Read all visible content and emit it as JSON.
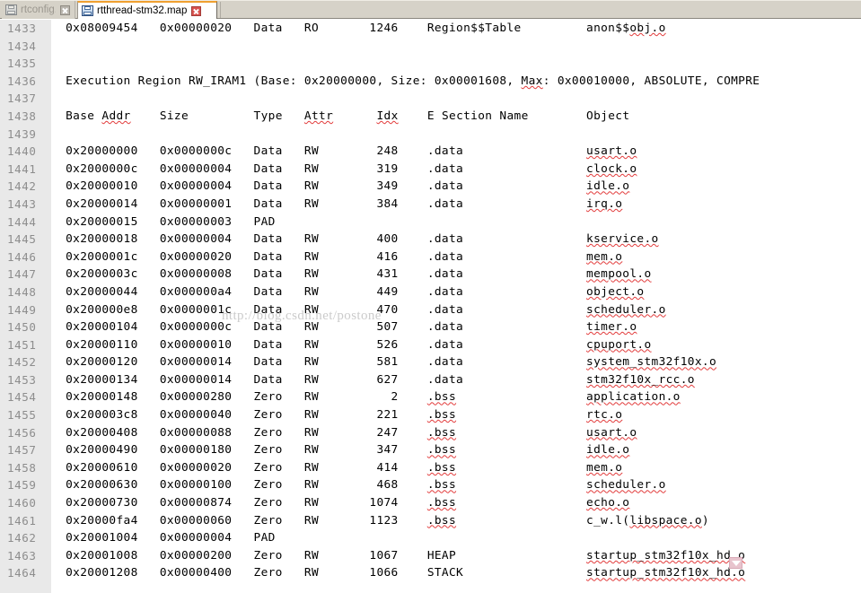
{
  "window": {
    "title": "rtthread-stm32.map"
  },
  "tabs": [
    {
      "label": "rtconfig.h",
      "icon": "save-file-icon",
      "close_icon": "close-icon",
      "active": false
    },
    {
      "label": "rtthread-stm32.map",
      "icon": "save-file-icon",
      "close_icon": "close-icon",
      "active": true
    }
  ],
  "watermark": "http://blog.csdn.net/postone",
  "editor": {
    "first_line_number": 1433,
    "columns": [
      "Base Addr",
      "Size",
      "Type",
      "Attr",
      "Idx",
      "E Section Name",
      "Object"
    ],
    "region_header": "Execution Region RW_IRAM1 (Base: 0x20000000, Size: 0x00001608, Max: 0x00010000, ABSOLUTE, COMPRE",
    "column_header": "Base Addr     Size         Type   Attr      Idx    E Section Name        Object",
    "lines": [
      {
        "n": 1433,
        "text": "  0x08009454   0x00000020   Data   RO       1246    Region$$Table         anon$$obj.o",
        "sq": [
          "obj.o"
        ]
      },
      {
        "n": 1434,
        "text": ""
      },
      {
        "n": 1435,
        "text": ""
      },
      {
        "n": 1436,
        "text": "  Execution Region RW_IRAM1 (Base: 0x20000000, Size: 0x00001608, Max: 0x00010000, ABSOLUTE, COMPRE",
        "sq": [
          "Max"
        ]
      },
      {
        "n": 1437,
        "text": ""
      },
      {
        "n": 1438,
        "text": "  Base Addr    Size         Type   Attr      Idx    E Section Name        Object",
        "sq": [
          "Addr",
          "Attr",
          "Idx"
        ]
      },
      {
        "n": 1439,
        "text": ""
      },
      {
        "n": 1440,
        "text": "  0x20000000   0x0000000c   Data   RW        248    .data                 usart.o",
        "sq": [
          "usart.o"
        ]
      },
      {
        "n": 1441,
        "text": "  0x2000000c   0x00000004   Data   RW        319    .data                 clock.o",
        "sq": [
          "clock.o"
        ]
      },
      {
        "n": 1442,
        "text": "  0x20000010   0x00000004   Data   RW        349    .data                 idle.o",
        "sq": [
          "idle.o"
        ]
      },
      {
        "n": 1443,
        "text": "  0x20000014   0x00000001   Data   RW        384    .data                 irq.o",
        "sq": [
          "irq.o"
        ]
      },
      {
        "n": 1444,
        "text": "  0x20000015   0x00000003   PAD"
      },
      {
        "n": 1445,
        "text": "  0x20000018   0x00000004   Data   RW        400    .data                 kservice.o",
        "sq": [
          "kservice.o"
        ]
      },
      {
        "n": 1446,
        "text": "  0x2000001c   0x00000020   Data   RW        416    .data                 mem.o",
        "sq": [
          "mem.o"
        ]
      },
      {
        "n": 1447,
        "text": "  0x2000003c   0x00000008   Data   RW        431    .data                 mempool.o",
        "sq": [
          "mempool.o"
        ]
      },
      {
        "n": 1448,
        "text": "  0x20000044   0x000000a4   Data   RW        449    .data                 object.o",
        "sq": [
          "object.o"
        ]
      },
      {
        "n": 1449,
        "text": "  0x200000e8   0x0000001c   Data   RW        470    .data                 scheduler.o",
        "sq": [
          "scheduler.o"
        ]
      },
      {
        "n": 1450,
        "text": "  0x20000104   0x0000000c   Data   RW        507    .data                 timer.o",
        "sq": [
          "timer.o"
        ]
      },
      {
        "n": 1451,
        "text": "  0x20000110   0x00000010   Data   RW        526    .data                 cpuport.o",
        "sq": [
          "cpuport.o"
        ]
      },
      {
        "n": 1452,
        "text": "  0x20000120   0x00000014   Data   RW        581    .data                 system_stm32f10x.o",
        "sq": [
          "system_stm32f10x.o"
        ]
      },
      {
        "n": 1453,
        "text": "  0x20000134   0x00000014   Data   RW        627    .data                 stm32f10x_rcc.o",
        "sq": [
          "stm32f10x_rcc.o"
        ]
      },
      {
        "n": 1454,
        "text": "  0x20000148   0x00000280   Zero   RW          2    .bss                  application.o",
        "sq": [
          ".bss",
          "application.o"
        ]
      },
      {
        "n": 1455,
        "text": "  0x200003c8   0x00000040   Zero   RW        221    .bss                  rtc.o",
        "sq": [
          ".bss",
          "rtc.o"
        ]
      },
      {
        "n": 1456,
        "text": "  0x20000408   0x00000088   Zero   RW        247    .bss                  usart.o",
        "sq": [
          ".bss",
          "usart.o"
        ]
      },
      {
        "n": 1457,
        "text": "  0x20000490   0x00000180   Zero   RW        347    .bss                  idle.o",
        "sq": [
          ".bss",
          "idle.o"
        ]
      },
      {
        "n": 1458,
        "text": "  0x20000610   0x00000020   Zero   RW        414    .bss                  mem.o",
        "sq": [
          ".bss",
          "mem.o"
        ]
      },
      {
        "n": 1459,
        "text": "  0x20000630   0x00000100   Zero   RW        468    .bss                  scheduler.o",
        "sq": [
          ".bss",
          "scheduler.o"
        ]
      },
      {
        "n": 1460,
        "text": "  0x20000730   0x00000874   Zero   RW       1074    .bss                  echo.o",
        "sq": [
          ".bss",
          "echo.o"
        ]
      },
      {
        "n": 1461,
        "text": "  0x20000fa4   0x00000060   Zero   RW       1123    .bss                  c_w.l(libspace.o)",
        "sq": [
          ".bss",
          "libspace.o"
        ]
      },
      {
        "n": 1462,
        "text": "  0x20001004   0x00000004   PAD"
      },
      {
        "n": 1463,
        "text": "  0x20001008   0x00000200   Zero   RW       1067    HEAP                  startup_stm32f10x_hd.o",
        "sq": [
          "startup_stm32f10x_hd.o"
        ]
      },
      {
        "n": 1464,
        "text": "  0x20001208   0x00000400   Zero   RW       1066    STACK                 startup_stm32f10x_hd.o",
        "sq": [
          "startup_stm32f10x_hd.o"
        ]
      }
    ]
  },
  "markers": {
    "chevron_icon": "chevron-down-icon"
  },
  "colors": {
    "tab_active_accent": "#f0a030",
    "tab_bar_bg": "#d6d2c8",
    "gutter_bg": "#e9e9e9",
    "line_number_fg": "#8d8d8d",
    "spell_underline": "#e23b3b",
    "close_button": "#d9534f"
  }
}
